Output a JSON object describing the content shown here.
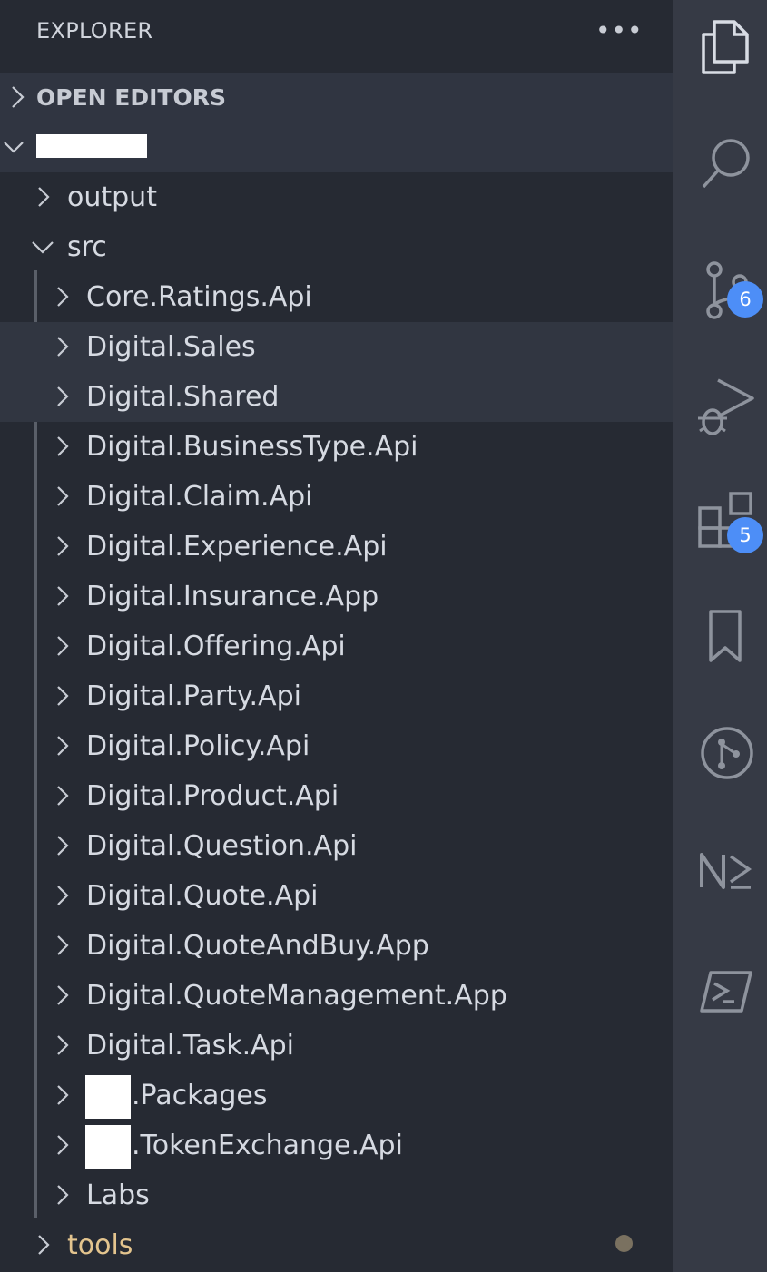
{
  "explorer": {
    "title": "EXPLORER",
    "more_actions_icon": "more-icon",
    "sections": {
      "open_editors": "OPEN EDITORS"
    }
  },
  "tree": {
    "output": "output",
    "src": "src",
    "src_children": [
      "Core.Ratings.Api",
      "Digital.Sales",
      "Digital.Shared",
      "Digital.BusinessType.Api",
      "Digital.Claim.Api",
      "Digital.Experience.Api",
      "Digital.Insurance.App",
      "Digital.Offering.Api",
      "Digital.Party.Api",
      "Digital.Policy.Api",
      "Digital.Product.Api",
      "Digital.Question.Api",
      "Digital.Quote.Api",
      "Digital.QuoteAndBuy.App",
      "Digital.QuoteManagement.App",
      "Digital.Task.Api",
      ".Packages",
      ".TokenExchange.Api",
      "Labs"
    ],
    "tools": "tools"
  },
  "activity_bar": {
    "items": [
      "explorer-icon",
      "search-icon",
      "source-control-icon",
      "run-debug-icon",
      "extensions-icon",
      "bookmarks-icon",
      "gitlens-icon",
      "nx-console-icon",
      "powershell-icon"
    ],
    "source_control_badge": "6",
    "extensions_badge": "5"
  },
  "colors": {
    "sidebar_bg": "#262a33",
    "activity_bg": "#363a45",
    "badge": "#4d8ef7",
    "modified_folder": "#e3c48e"
  }
}
